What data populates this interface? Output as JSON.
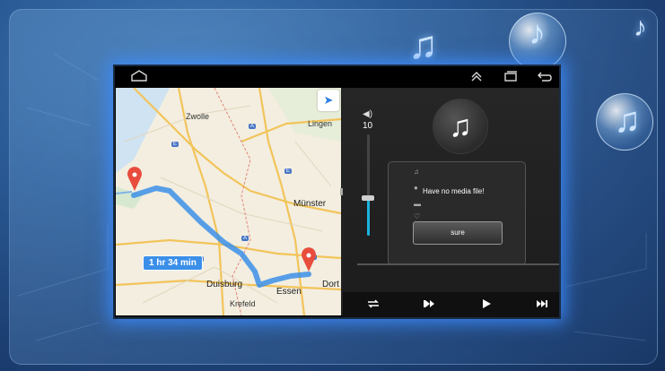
{
  "status_bar": {
    "home_icon": "home-icon",
    "up_icon": "chevron-up-icon",
    "recents_icon": "recents-icon",
    "back_icon": "back-icon"
  },
  "map": {
    "places": {
      "zwolle": "Zwolle",
      "lingen": "Lingen",
      "munster": "Münster",
      "duisburg": "Duisburg",
      "essen": "Essen",
      "dort": "Dort",
      "krefeld": "Krefeld"
    },
    "route_time": "1 hr 34 min",
    "highway_labels": [
      "E",
      "A",
      "E",
      "A",
      "A",
      "E"
    ],
    "route_color": "#3b8fe8",
    "pin_color": "#e84c3d"
  },
  "player": {
    "volume": 10,
    "volume_level": 0.4,
    "dialog": {
      "message": "Have no media file!",
      "button_label": "sure"
    },
    "controls": [
      "repeat-icon",
      "previous-icon",
      "play-icon",
      "next-icon"
    ]
  },
  "accent_color": "#1bb3e0"
}
